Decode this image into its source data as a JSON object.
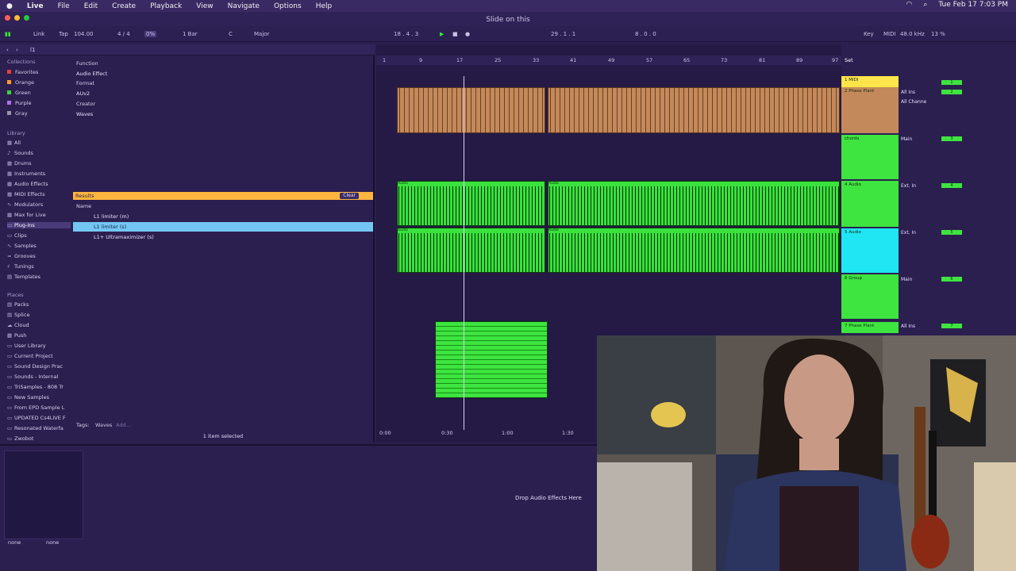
{
  "menubar": {
    "app": "Live",
    "items": [
      "File",
      "Edit",
      "Create",
      "Playback",
      "View",
      "Navigate",
      "Options",
      "Help"
    ],
    "clock": "Tue Feb 17  7:03 PM"
  },
  "window": {
    "title": "Slide on this"
  },
  "control": {
    "link": "Link",
    "tap": "Tap",
    "tempo": "104.00",
    "signature": "4 / 4",
    "groove": "0%",
    "quantize": "1 Bar",
    "key": "C",
    "scale": "Major",
    "position": "18 .  4 .  3",
    "loop_start": "29 .  1 .  1",
    "loop_len": "8 .  0 .  0",
    "key_btn": "Key",
    "midi_btn": "MIDI",
    "sample_rate": "48.0 kHz",
    "cpu": "13 %"
  },
  "browser": {
    "search": "l1",
    "collections_header": "Collections",
    "collections": [
      {
        "label": "Favorites",
        "color": "#e04040"
      },
      {
        "label": "Orange",
        "color": "#ff9a2e"
      },
      {
        "label": "Green",
        "color": "#38d43a"
      },
      {
        "label": "Purple",
        "color": "#b072e8"
      },
      {
        "label": "Gray",
        "color": "#9a94a8"
      }
    ],
    "library_header": "Library",
    "library": [
      "All",
      "Sounds",
      "Drums",
      "Instruments",
      "Audio Effects",
      "MIDI Effects",
      "Modulators",
      "Max for Live",
      "Plug-Ins",
      "Clips",
      "Samples",
      "Grooves",
      "Tunings",
      "Templates"
    ],
    "places_header": "Places",
    "places": [
      "Packs",
      "Splice",
      "Cloud",
      "Push",
      "User Library",
      "Current Project",
      "Sound Design Prac",
      "Sounds - Internal",
      "TriSamples - 808 Tr",
      "New Samples",
      "From EPD Sample L",
      "UPDATED Cs4LIVE F",
      "Resonated Waterfa",
      "Zwobot"
    ],
    "filters": {
      "function_label": "Function",
      "function_value": "Audio Effect",
      "format_label": "Format",
      "format_value": "AUv2",
      "creator_label": "Creator",
      "creator_value": "Waves"
    },
    "results_label": "Results",
    "clear": "Clear",
    "name_col": "Name",
    "results": [
      "L1 limiter (m)",
      "L1 limiter (s)",
      "L1+ Ultramaximizer (s)"
    ],
    "tags_label": "Tags:",
    "tags_value": "Waves",
    "tags_add": "Add...",
    "status": "1 item selected"
  },
  "ruler": [
    "1",
    "9",
    "17",
    "25",
    "33",
    "41",
    "49",
    "57",
    "65",
    "73",
    "81",
    "89",
    "97"
  ],
  "timeline": [
    "0:00",
    "0:30",
    "1:00",
    "1:30"
  ],
  "set_label": "Set",
  "tracks": [
    {
      "name": "1 MIDI",
      "input": "All Ins",
      "num": "1",
      "color": "#ffe54a"
    },
    {
      "name": "2 Phase Plant",
      "input": "All Channe",
      "num": "2",
      "color": "#c4895a"
    },
    {
      "name": "chords",
      "input": "Main",
      "num": "3",
      "color": "#3ee43f"
    },
    {
      "name": "4 Audio",
      "input": "Ext. In",
      "num": "4",
      "color": "#3ee43f"
    },
    {
      "name": "5 Audio",
      "input": "Ext. In",
      "num": "5",
      "color": "#1fe6f2"
    },
    {
      "name": "6 Group",
      "input": "Main",
      "num": "6",
      "color": "#3ee43f"
    },
    {
      "name": "7 Phase Plant",
      "input": "All Ins",
      "num": "7",
      "color": "#3ee43f"
    }
  ],
  "clip_label": "Audio",
  "device": {
    "drop": "Drop Audio Effects Here",
    "none1": "none",
    "none2": "none"
  }
}
